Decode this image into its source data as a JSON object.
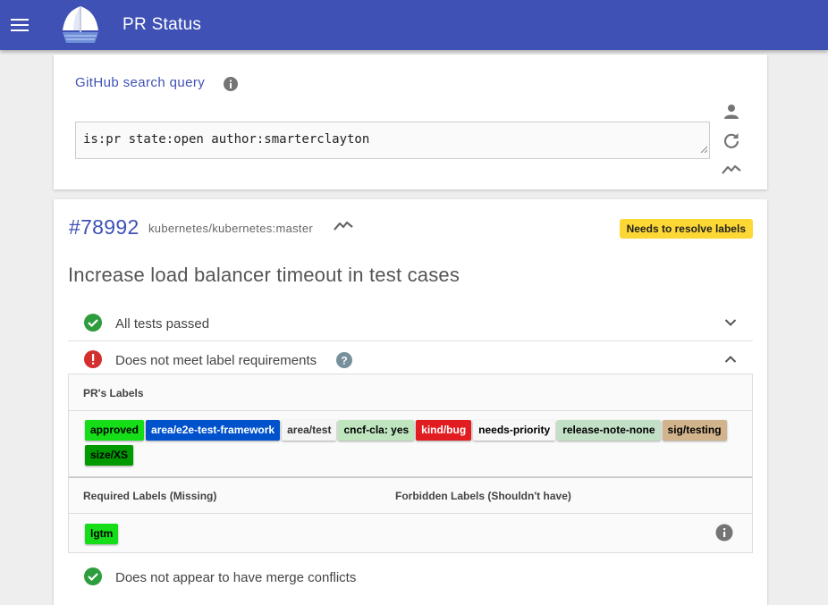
{
  "app": {
    "title": "PR Status",
    "menu_icon": "menu-icon",
    "logo_icon": "kubernetes-sail-logo",
    "bar_color": "#3f51b5"
  },
  "query": {
    "label": "GitHub search query",
    "value": "is:pr state:open author:smarterclayton",
    "icons": [
      "person-icon",
      "refresh-icon",
      "trend-icon"
    ]
  },
  "pr": {
    "number": "#78992",
    "repo": "kubernetes/kubernetes:master",
    "badge": "Needs to resolve labels",
    "title": "Increase load balancer timeout in test cases",
    "checks": [
      {
        "label": "All tests passed",
        "status": "ok"
      },
      {
        "label": "Does not meet label requirements",
        "status": "error"
      },
      {
        "label": "Does not appear to have merge conflicts",
        "status": "ok"
      }
    ],
    "labels_header": "PR's Labels",
    "labels": [
      {
        "name": "approved",
        "bg": "#15dd18",
        "fg": "#000"
      },
      {
        "name": "area/e2e-test-framework",
        "bg": "#0052cc",
        "fg": "#fff"
      },
      {
        "name": "area/test",
        "bg": "#f5f5f5",
        "fg": "#333"
      },
      {
        "name": "cncf-cla: yes",
        "bg": "#bfe5bf",
        "fg": "#000"
      },
      {
        "name": "kind/bug",
        "bg": "#e11d21",
        "fg": "#fff"
      },
      {
        "name": "needs-priority",
        "bg": "#f7f7f7",
        "fg": "#000"
      },
      {
        "name": "release-note-none",
        "bg": "#c2e0c6",
        "fg": "#000"
      },
      {
        "name": "sig/testing",
        "bg": "#d2b48c",
        "fg": "#000"
      },
      {
        "name": "size/XS",
        "bg": "#009900",
        "fg": "#000"
      }
    ],
    "required_header": "Required Labels (Missing)",
    "forbidden_header": "Forbidden Labels (Shouldn't have)",
    "required_labels": [
      {
        "name": "lgtm",
        "bg": "#15dd18",
        "fg": "#000"
      }
    ]
  },
  "colors": {
    "ok": "#2e9d3e",
    "error": "#d32f2f",
    "accent": "#3f51b5",
    "badge": "#fdd835"
  }
}
